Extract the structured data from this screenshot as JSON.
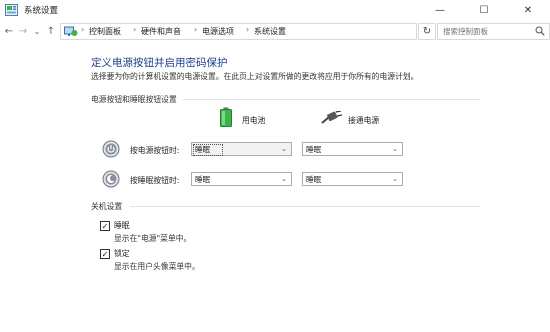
{
  "window": {
    "title": "系统设置",
    "minimize_glyph": "—",
    "maximize_glyph": "☐",
    "close_glyph": "✕"
  },
  "nav": {
    "back_glyph": "←",
    "forward_glyph": "→",
    "recent_glyph": "⌄",
    "up_glyph": "↑",
    "breadcrumbs": [
      "控制面板",
      "硬件和声音",
      "电源选项",
      "系统设置"
    ],
    "separator": "›",
    "dropdown_glyph": "⌄",
    "refresh_glyph": "↻"
  },
  "search": {
    "placeholder": "搜索控制面板"
  },
  "page": {
    "heading": "定义电源按钮并启用密码保护",
    "description": "选择要为你的计算机设置的电源设置。在此页上对设置所做的更改将应用于你所有的电源计划。"
  },
  "power_buttons": {
    "section_title": "电源按钮和睡眠按钮设置",
    "col_battery": "用电池",
    "col_plugged": "接通电源",
    "rows": [
      {
        "label": "按电源按钮时:",
        "battery": "睡眠",
        "plugged": "睡眠"
      },
      {
        "label": "按睡眠按钮时:",
        "battery": "睡眠",
        "plugged": "睡眠"
      }
    ],
    "arrow_glyph": "⌄"
  },
  "shutdown": {
    "section_title": "关机设置",
    "check_glyph": "✓",
    "options": [
      {
        "label": "睡眠",
        "sub": "显示在\"电源\"菜单中。",
        "checked": true
      },
      {
        "label": "锁定",
        "sub": "显示在用户头像菜单中。",
        "checked": true
      }
    ]
  },
  "colors": {
    "heading": "#1e3f8a",
    "battery_green": "#3bb54a"
  }
}
